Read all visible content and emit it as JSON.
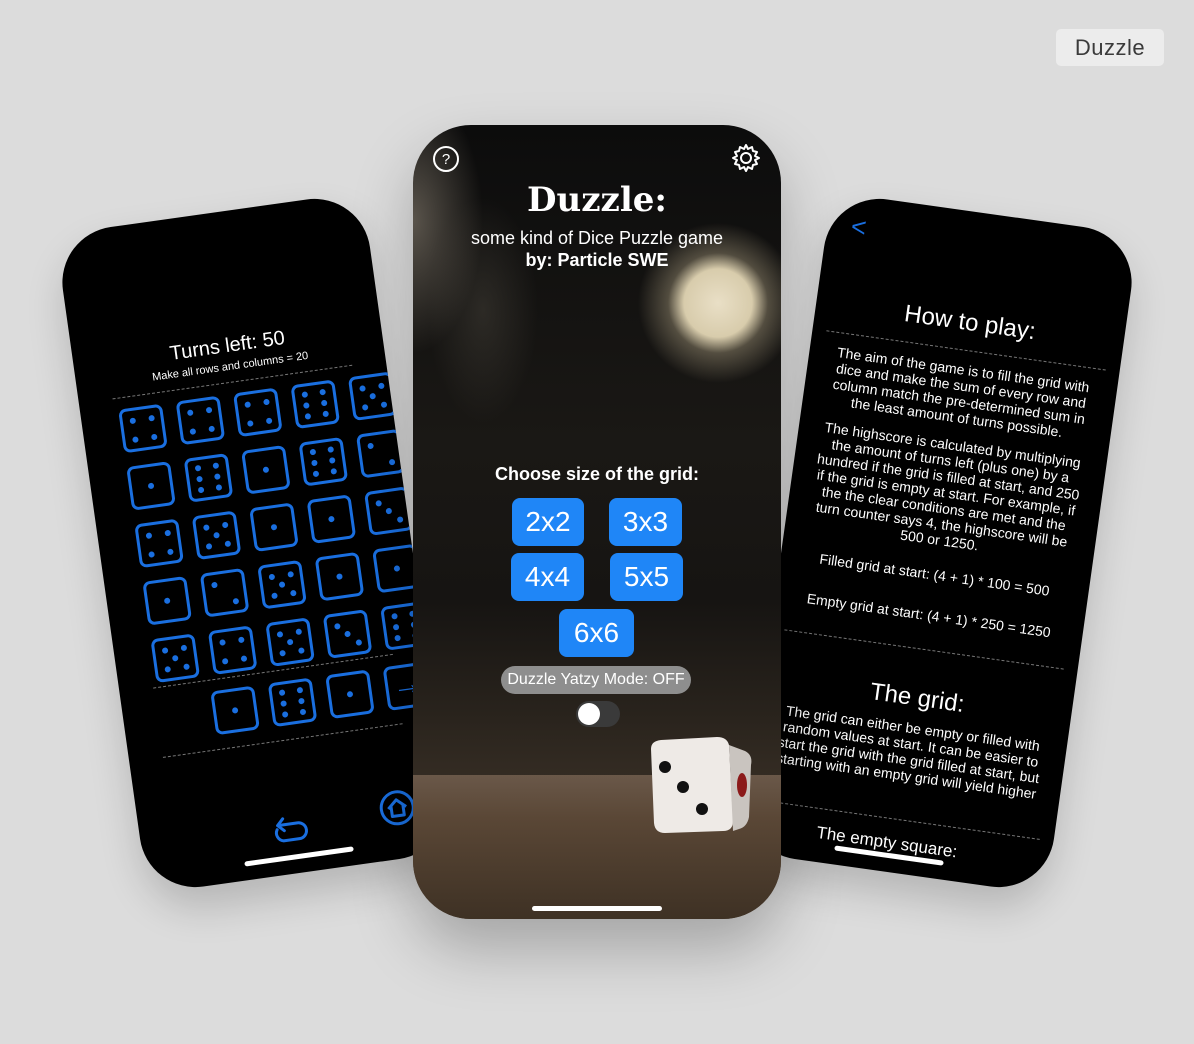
{
  "badge": "Duzzle",
  "left": {
    "turns_label": "Turns left: 50",
    "instruction": "Make all rows and columns = 20",
    "grid": [
      4,
      4,
      4,
      6,
      5,
      1,
      6,
      1,
      6,
      2,
      4,
      5,
      1,
      1,
      3,
      1,
      2,
      5,
      1,
      1,
      5,
      4,
      5,
      3,
      6
    ],
    "tray": [
      1,
      6,
      1
    ],
    "icons": {
      "next": "arrow-right-icon",
      "undo": "undo-icon",
      "home": "home-icon"
    }
  },
  "center": {
    "title": "Duzzle:",
    "subtitle": "some kind of Dice Puzzle game",
    "byline": "by: Particle SWE",
    "choose_label": "Choose size of the grid:",
    "sizes": [
      "2x2",
      "3x3",
      "4x4",
      "5x5",
      "6x6"
    ],
    "yatzy_label": "Duzzle Yatzy Mode: OFF",
    "yatzy_on": false,
    "icons": {
      "help": "help-icon",
      "settings": "gear-icon"
    },
    "accent": "#1f86f7"
  },
  "right": {
    "back": "<",
    "heading": "How to play:",
    "p1": "The aim of the game is to fill the grid with dice and make the sum of every row and column match the pre-determined sum in the least amount of turns possible.",
    "p2": "The highscore is calculated by multiplying the amount of turns left (plus one) by a hundred if the grid is filled at start, and 250 if the grid is empty at start. For example, if the the clear conditions are met and the turn counter says 4, the highscore will be 500 or 1250.",
    "p3": "Filled grid at start: (4 + 1) * 100 = 500",
    "p4": "Empty grid at start: (4 + 1) * 250 = 1250",
    "grid_heading": "The grid:",
    "p5": "The grid can either be empty or filled with random values at start. It can be easier to start the grid with the grid filled at start, but starting with an empty grid will yield higher",
    "empty_heading": "The empty square:"
  }
}
